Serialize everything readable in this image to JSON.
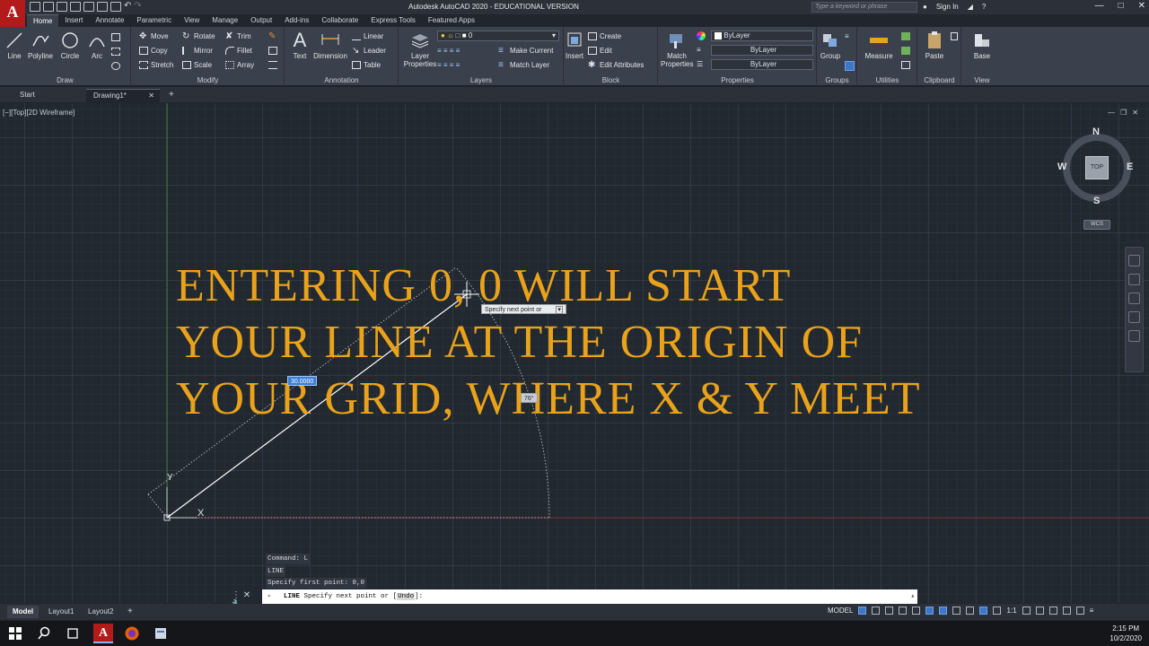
{
  "titlebar": {
    "app_logo": "A",
    "title": "Autodesk AutoCAD 2020 - EDUCATIONAL VERSION",
    "search_placeholder": "Type a keyword or phrase",
    "sign_in": "Sign In"
  },
  "ribbon_tabs": [
    "Home",
    "Insert",
    "Annotate",
    "Parametric",
    "View",
    "Manage",
    "Output",
    "Add-ins",
    "Collaborate",
    "Express Tools",
    "Featured Apps"
  ],
  "ribbon": {
    "draw": {
      "title": "Draw",
      "line": "Line",
      "polyline": "Polyline",
      "circle": "Circle",
      "arc": "Arc"
    },
    "modify": {
      "title": "Modify",
      "move": "Move",
      "rotate": "Rotate",
      "trim": "Trim",
      "copy": "Copy",
      "mirror": "Mirror",
      "fillet": "Fillet",
      "stretch": "Stretch",
      "scale": "Scale",
      "array": "Array"
    },
    "annotation": {
      "title": "Annotation",
      "text": "Text",
      "dimension": "Dimension",
      "linear": "Linear",
      "leader": "Leader",
      "table": "Table"
    },
    "layers": {
      "title": "Layers",
      "layer_properties_1": "Layer",
      "layer_properties_2": "Properties",
      "current_layer": "0",
      "make_current": "Make Current",
      "match_layer": "Match Layer"
    },
    "block": {
      "title": "Block",
      "insert": "Insert",
      "create": "Create",
      "edit": "Edit",
      "edit_attributes": "Edit Attributes"
    },
    "properties": {
      "title": "Properties",
      "match_1": "Match",
      "match_2": "Properties",
      "color": "ByLayer",
      "linetype": "ByLayer",
      "lineweight": "ByLayer"
    },
    "groups": {
      "title": "Groups",
      "group": "Group"
    },
    "utilities": {
      "title": "Utilities",
      "measure": "Measure"
    },
    "clipboard": {
      "title": "Clipboard",
      "paste": "Paste"
    },
    "view": {
      "title": "View",
      "base": "Base"
    }
  },
  "filetabs": {
    "start": "Start",
    "drawing": "Drawing1*"
  },
  "viewport": {
    "label": "[−][Top][2D Wireframe]",
    "overlay_lines": [
      "ENTERING  0, 0  WILL START",
      "YOUR LINE AT THE ORIGIN OF",
      "YOUR GRID, WHERE X & Y MEET"
    ],
    "tooltip": "Specify next point or",
    "length_tip": "30.0000",
    "angle_tip": "76°",
    "ucs_y": "Y",
    "ucs_x": "X"
  },
  "viewcube": {
    "n": "N",
    "s": "S",
    "e": "E",
    "w": "W",
    "face": "TOP",
    "wcs": "WCS"
  },
  "command_history": [
    "Command: L",
    "LINE",
    "Specify first point: 0,0"
  ],
  "command_line": {
    "prefix": "LINE",
    "prompt": "Specify next point or [",
    "option": "Undo",
    "suffix": "]:"
  },
  "layout_tabs": [
    "Model",
    "Layout1",
    "Layout2"
  ],
  "status": {
    "model": "MODEL",
    "scale": "1:1"
  },
  "taskbar": {
    "time": "2:15 PM",
    "date": "10/2/2020"
  },
  "colors": {
    "overlay_text": "#e9a21a",
    "accent": "#3d78c8",
    "logo": "#b31b1b"
  }
}
